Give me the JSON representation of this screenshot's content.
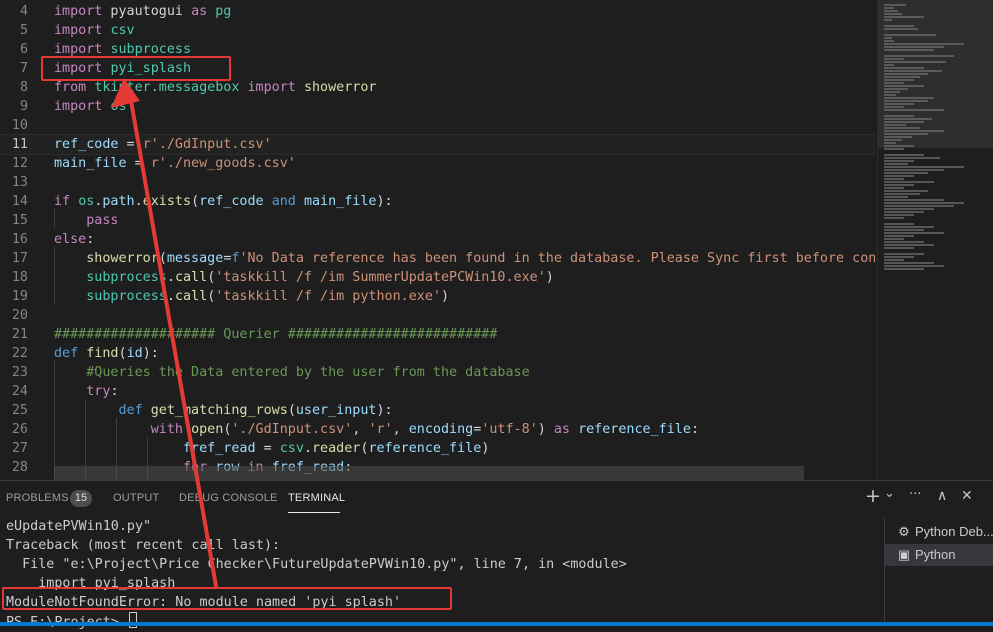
{
  "editor": {
    "lines": [
      {
        "num": "4",
        "tokens": [
          [
            "kw",
            "import"
          ],
          [
            "tx",
            " pyautogui "
          ],
          [
            "kw",
            "as"
          ],
          [
            "tx",
            " "
          ],
          [
            "md",
            "pg"
          ]
        ]
      },
      {
        "num": "5",
        "tokens": [
          [
            "kw",
            "import"
          ],
          [
            "tx",
            " "
          ],
          [
            "md",
            "csv"
          ]
        ]
      },
      {
        "num": "6",
        "tokens": [
          [
            "kw",
            "import"
          ],
          [
            "tx",
            " "
          ],
          [
            "md",
            "subprocess"
          ]
        ]
      },
      {
        "num": "7",
        "tokens": [
          [
            "kw",
            "import"
          ],
          [
            "tx",
            " "
          ],
          [
            "md",
            "pyi_splash"
          ]
        ]
      },
      {
        "num": "8",
        "tokens": [
          [
            "kw",
            "from"
          ],
          [
            "tx",
            " "
          ],
          [
            "md",
            "tkinter.messagebox"
          ],
          [
            "tx",
            " "
          ],
          [
            "kw",
            "import"
          ],
          [
            "tx",
            " "
          ],
          [
            "fn",
            "showerror"
          ]
        ]
      },
      {
        "num": "9",
        "tokens": [
          [
            "kw",
            "import"
          ],
          [
            "tx",
            " "
          ],
          [
            "md",
            "os"
          ]
        ]
      },
      {
        "num": "10",
        "tokens": []
      },
      {
        "num": "11",
        "tokens": [
          [
            "vr",
            "ref_code"
          ],
          [
            "tx",
            " = "
          ],
          [
            "st",
            "r'./GdInput.csv'"
          ]
        ],
        "current": true
      },
      {
        "num": "12",
        "tokens": [
          [
            "vr",
            "main_file"
          ],
          [
            "tx",
            " = "
          ],
          [
            "st",
            "r'./new_goods.csv'"
          ]
        ]
      },
      {
        "num": "13",
        "tokens": []
      },
      {
        "num": "14",
        "tokens": [
          [
            "kw",
            "if"
          ],
          [
            "tx",
            " "
          ],
          [
            "md",
            "os"
          ],
          [
            "tx",
            "."
          ],
          [
            "vr",
            "path"
          ],
          [
            "tx",
            "."
          ],
          [
            "fn",
            "exists"
          ],
          [
            "tx",
            "("
          ],
          [
            "vr",
            "ref_code"
          ],
          [
            "tx",
            " "
          ],
          [
            "kb",
            "and"
          ],
          [
            "tx",
            " "
          ],
          [
            "vr",
            "main_file"
          ],
          [
            "tx",
            "):"
          ]
        ]
      },
      {
        "num": "15",
        "tokens": [
          [
            "tx",
            "    "
          ],
          [
            "kw",
            "pass"
          ]
        ]
      },
      {
        "num": "16",
        "tokens": [
          [
            "kw",
            "else"
          ],
          [
            "tx",
            ":"
          ]
        ]
      },
      {
        "num": "17",
        "tokens": [
          [
            "tx",
            "    "
          ],
          [
            "fn",
            "showerror"
          ],
          [
            "tx",
            "("
          ],
          [
            "vr",
            "message"
          ],
          [
            "tx",
            "="
          ],
          [
            "kb",
            "f"
          ],
          [
            "st",
            "'No Data reference has been found in the database. Please Sync first before continui"
          ]
        ]
      },
      {
        "num": "18",
        "tokens": [
          [
            "tx",
            "    "
          ],
          [
            "md",
            "subprocess"
          ],
          [
            "tx",
            "."
          ],
          [
            "fn",
            "call"
          ],
          [
            "tx",
            "("
          ],
          [
            "st",
            "'taskkill /f /im SummerUpdatePCWin10.exe'"
          ],
          [
            "tx",
            ")"
          ]
        ]
      },
      {
        "num": "19",
        "tokens": [
          [
            "tx",
            "    "
          ],
          [
            "md",
            "subprocess"
          ],
          [
            "tx",
            "."
          ],
          [
            "fn",
            "call"
          ],
          [
            "tx",
            "("
          ],
          [
            "st",
            "'taskkill /f /im python.exe'"
          ],
          [
            "tx",
            ")"
          ]
        ]
      },
      {
        "num": "20",
        "tokens": []
      },
      {
        "num": "21",
        "tokens": [
          [
            "cm",
            "#################### Querier ##########################"
          ]
        ]
      },
      {
        "num": "22",
        "tokens": [
          [
            "kb",
            "def"
          ],
          [
            "tx",
            " "
          ],
          [
            "fn",
            "find"
          ],
          [
            "tx",
            "("
          ],
          [
            "vr",
            "id"
          ],
          [
            "tx",
            "):"
          ]
        ]
      },
      {
        "num": "23",
        "tokens": [
          [
            "tx",
            "    "
          ],
          [
            "cm",
            "#Queries the Data entered by the user from the database"
          ]
        ]
      },
      {
        "num": "24",
        "tokens": [
          [
            "tx",
            "    "
          ],
          [
            "kw",
            "try"
          ],
          [
            "tx",
            ":"
          ]
        ]
      },
      {
        "num": "25",
        "tokens": [
          [
            "tx",
            "        "
          ],
          [
            "kb",
            "def"
          ],
          [
            "tx",
            " "
          ],
          [
            "fn",
            "get_matching_rows"
          ],
          [
            "tx",
            "("
          ],
          [
            "vr",
            "user_input"
          ],
          [
            "tx",
            "):"
          ]
        ]
      },
      {
        "num": "26",
        "tokens": [
          [
            "tx",
            "            "
          ],
          [
            "kw",
            "with"
          ],
          [
            "tx",
            " "
          ],
          [
            "fn",
            "open"
          ],
          [
            "tx",
            "("
          ],
          [
            "st",
            "'./GdInput.csv'"
          ],
          [
            "tx",
            ", "
          ],
          [
            "st",
            "'r'"
          ],
          [
            "tx",
            ", "
          ],
          [
            "vr",
            "encoding"
          ],
          [
            "tx",
            "="
          ],
          [
            "st",
            "'utf-8'"
          ],
          [
            "tx",
            ") "
          ],
          [
            "kw",
            "as"
          ],
          [
            "tx",
            " "
          ],
          [
            "vr",
            "reference_file"
          ],
          [
            "tx",
            ":"
          ]
        ]
      },
      {
        "num": "27",
        "tokens": [
          [
            "tx",
            "                "
          ],
          [
            "vr",
            "fref_read"
          ],
          [
            "tx",
            " = "
          ],
          [
            "md",
            "csv"
          ],
          [
            "tx",
            "."
          ],
          [
            "fn",
            "reader"
          ],
          [
            "tx",
            "("
          ],
          [
            "vr",
            "reference_file"
          ],
          [
            "tx",
            ")"
          ]
        ]
      },
      {
        "num": "28",
        "tokens": [
          [
            "tx",
            "                "
          ],
          [
            "kw",
            "for"
          ],
          [
            "tx",
            " "
          ],
          [
            "vr",
            "row"
          ],
          [
            "tx",
            " "
          ],
          [
            "kw",
            "in"
          ],
          [
            "tx",
            " "
          ],
          [
            "vr",
            "fref_read"
          ],
          [
            "tx",
            ":"
          ]
        ]
      }
    ]
  },
  "panel": {
    "tabs": {
      "problems": "PROBLEMS",
      "problems_count": "15",
      "output": "OUTPUT",
      "debug_console": "DEBUG CONSOLE",
      "terminal": "TERMINAL"
    },
    "actions": {
      "add": "+",
      "dropdown": "⌄",
      "more": "···",
      "maximize": "∧",
      "close": "✕"
    },
    "terminal_lines": [
      "eUpdatePVWin10.py\"",
      "Traceback (most recent call last):",
      "  File \"e:\\Project\\Price Checker\\FutureUpdatePVWin10.py\", line 7, in <module>",
      "    import pyi_splash",
      "ModuleNotFoundError: No module named 'pyi_splash'",
      "PS E:\\Project> "
    ],
    "terminal_instances": [
      {
        "icon": "⚙",
        "label": "Python Deb..."
      },
      {
        "icon": "▣",
        "label": "Python"
      }
    ]
  },
  "colors": {
    "annotation_red": "#e53935",
    "accent_blue": "#007acc"
  }
}
